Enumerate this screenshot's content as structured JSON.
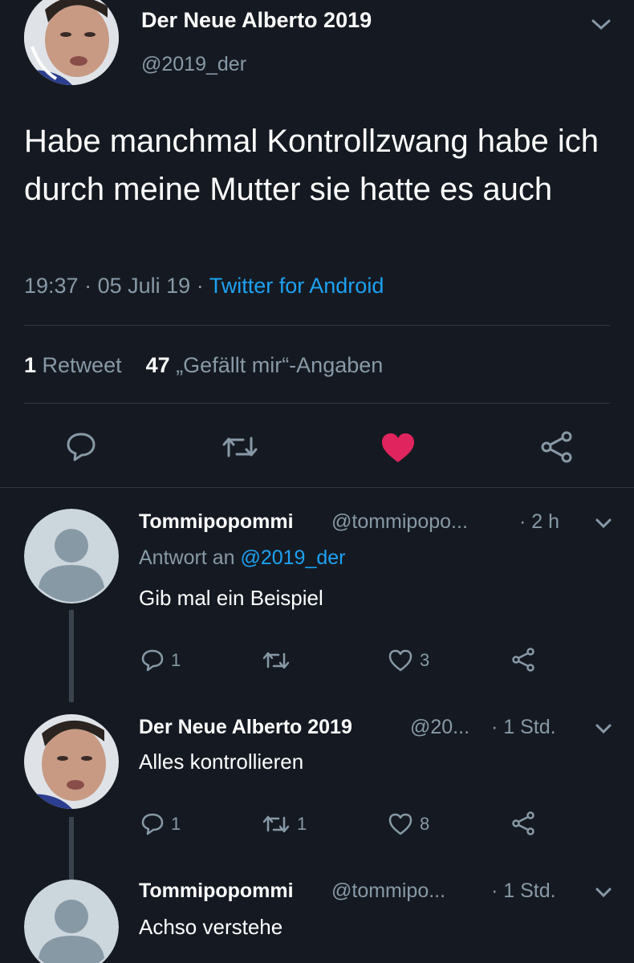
{
  "main_tweet": {
    "author_name": "Der Neue Alberto 2019",
    "author_handle": "@2019_der",
    "text": "Habe manchmal Kontrollzwang habe ich durch meine Mutter sie hatte es auch",
    "time": "19:37",
    "date": "05 Juli 19",
    "separator": "·",
    "source": "Twitter for Android",
    "retweet_count": "1",
    "retweet_label": "Retweet",
    "like_count": "47",
    "like_label": "„Gefällt mir“-Angaben"
  },
  "replies": [
    {
      "name": "Tommipopommi",
      "handle": "@tommipopo...",
      "time": "· 2 h",
      "reply_to_label": "Antwort an",
      "reply_to_handle": "@2019_der",
      "text": "Gib mal ein Beispiel",
      "reply_count": "1",
      "retweet_count": "",
      "like_count": "3"
    },
    {
      "name": "Der Neue Alberto 2019",
      "handle": "@20...",
      "time": "· 1 Std.",
      "text": "Alles kontrollieren",
      "reply_count": "1",
      "retweet_count": "1",
      "like_count": "8"
    },
    {
      "name": "Tommipopommi",
      "handle": "@tommipo...",
      "time": "· 1 Std.",
      "text": "Achso verstehe"
    }
  ],
  "colors": {
    "background": "#151a22",
    "accent": "#1da1f2",
    "like": "#e0245e",
    "secondary_text": "#8899a6"
  }
}
